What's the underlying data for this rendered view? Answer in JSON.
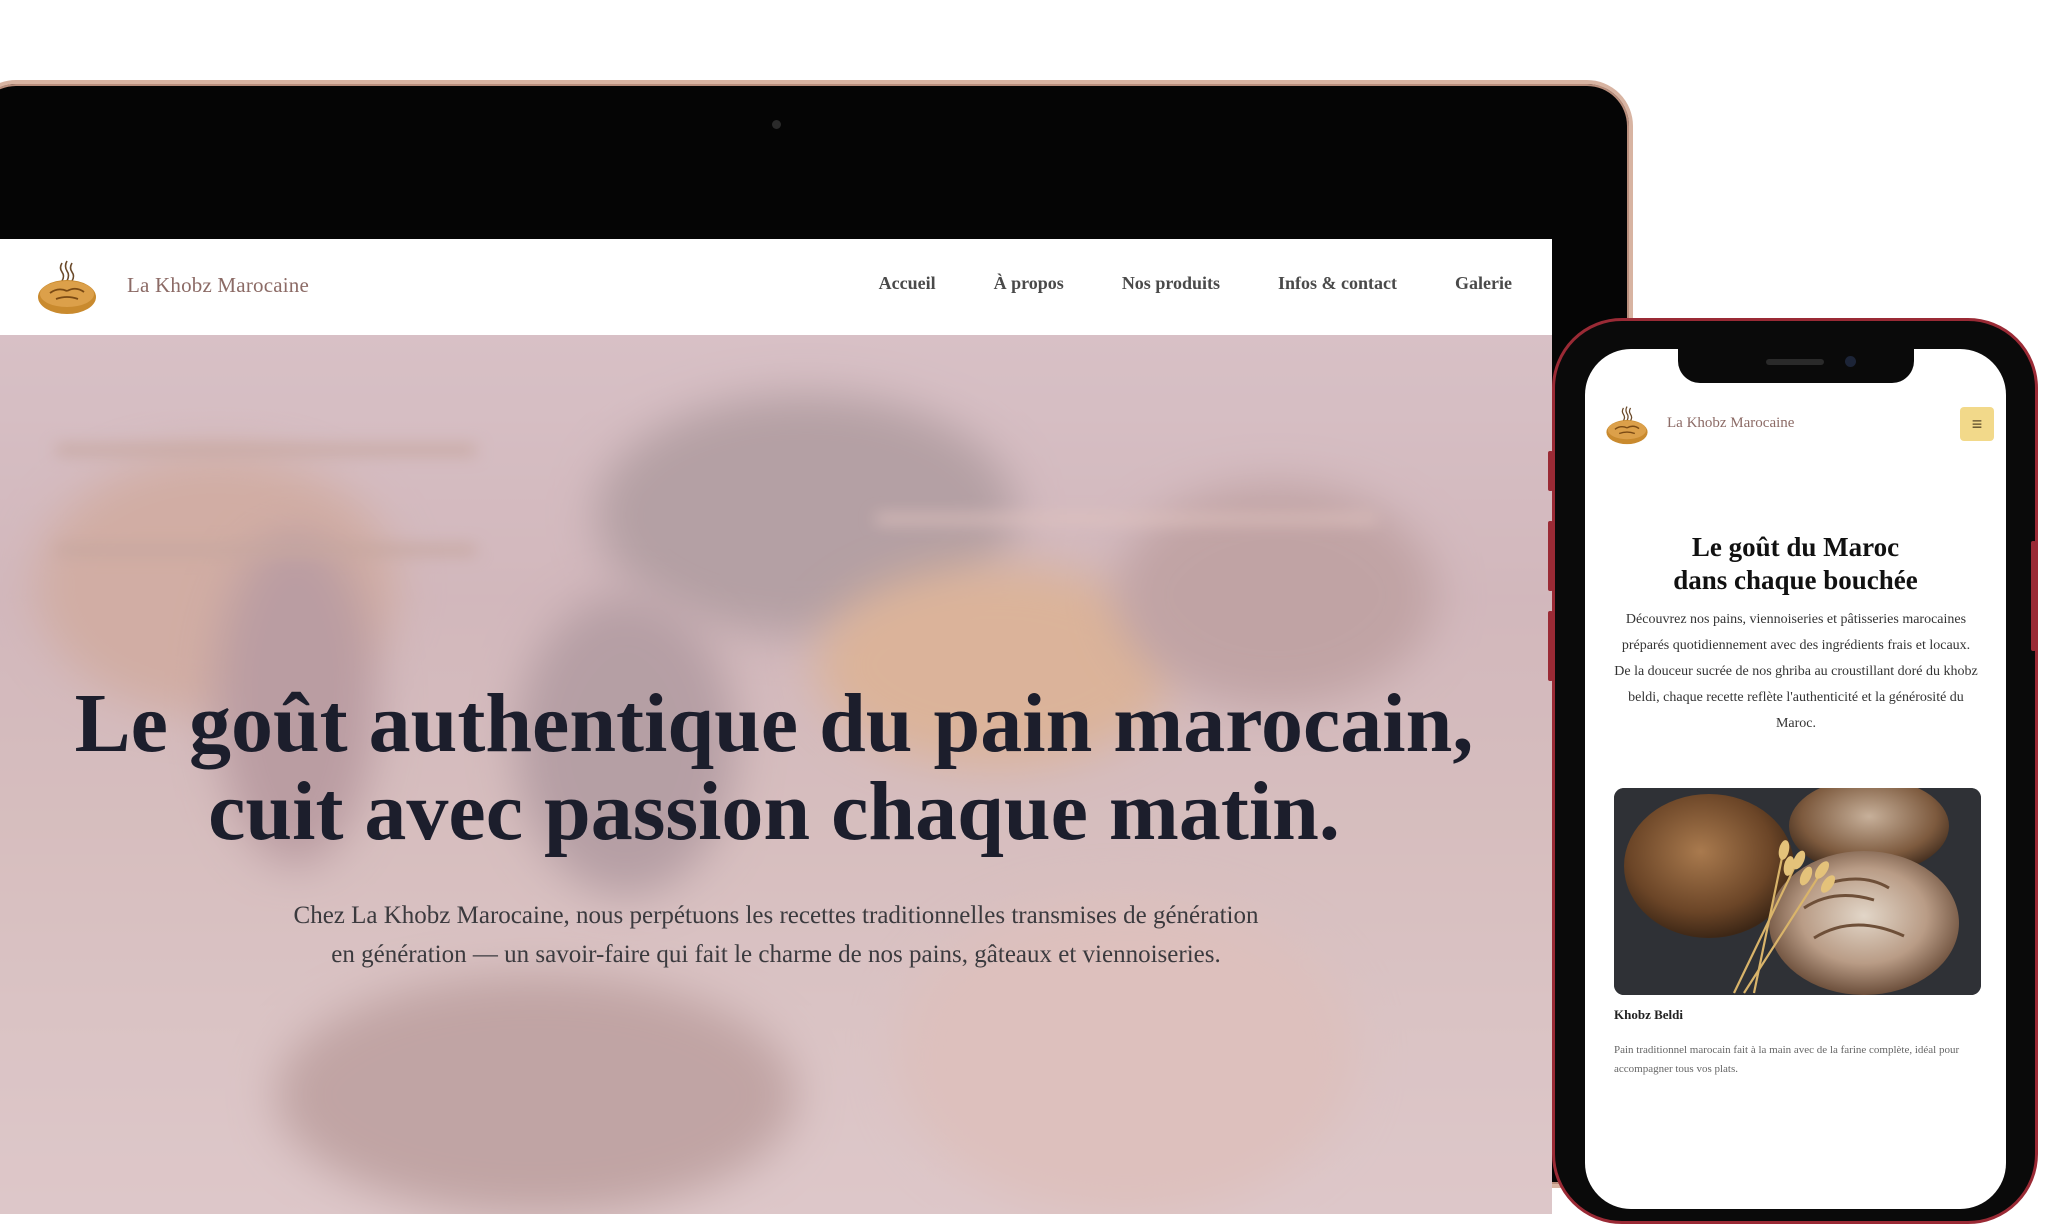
{
  "desktop": {
    "brand": "La Khobz Marocaine",
    "nav": [
      "Accueil",
      "À propos",
      "Nos produits",
      "Infos & contact",
      "Galerie"
    ],
    "hero": {
      "title_line1": "Le goût authentique du pain marocain,",
      "title_line2": "cuit avec passion chaque matin.",
      "subtitle_line1": "Chez La Khobz Marocaine, nous perpétuons les recettes traditionnelles transmises de génération",
      "subtitle_line2": "en génération — un savoir-faire qui fait le charme de nos pains, gâteaux et viennoiseries."
    }
  },
  "mobile": {
    "brand": "La Khobz Marocaine",
    "menu_icon": "≡",
    "title_line1": "Le goût du Maroc",
    "title_line2": "dans chaque bouchée",
    "description": "Découvrez nos pains, viennoiseries et pâtisseries marocaines préparés quotidiennement avec des ingrédients frais et locaux. De la douceur sucrée de nos ghriba au croustillant doré du khobz beldi, chaque recette reflète l'authenticité et la générosité du Maroc.",
    "product": {
      "name": "Khobz Beldi",
      "description": "Pain traditionnel marocain fait à la main avec de la farine complète, idéal pour accompagner tous vos plats."
    }
  },
  "colors": {
    "brand_text": "#8c6b66",
    "menu_button": "#f2d98a",
    "phone_frame": "#9a2a35",
    "laptop_frame": "#d8b4a2"
  },
  "icons": [
    "bread-logo-icon",
    "hamburger-menu-icon"
  ]
}
